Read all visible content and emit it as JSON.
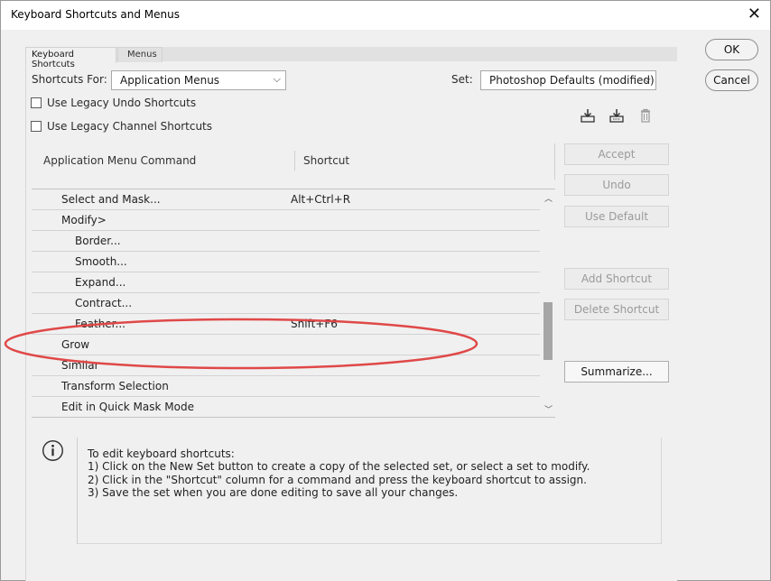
{
  "window": {
    "title": "Keyboard Shortcuts and Menus"
  },
  "tabs": [
    {
      "label": "Keyboard Shortcuts",
      "active": true
    },
    {
      "label": "Menus",
      "active": false
    }
  ],
  "shortcuts_for": {
    "label": "Shortcuts For:",
    "value": "Application Menus"
  },
  "set": {
    "label": "Set:",
    "value": "Photoshop Defaults (modified)"
  },
  "checkboxes": [
    {
      "label": "Use Legacy Undo Shortcuts",
      "checked": false
    },
    {
      "label": "Use Legacy Channel Shortcuts",
      "checked": false
    }
  ],
  "icons": [
    "save-set-icon",
    "save-as-set-icon",
    "delete-set-icon"
  ],
  "columns": {
    "command": "Application Menu Command",
    "shortcut": "Shortcut"
  },
  "rows": [
    {
      "command": "Select and Mask...",
      "shortcut": "Alt+Ctrl+R",
      "level": 1
    },
    {
      "command": "Modify>",
      "shortcut": "",
      "level": 1
    },
    {
      "command": "Border...",
      "shortcut": "",
      "level": 2
    },
    {
      "command": "Smooth...",
      "shortcut": "",
      "level": 2
    },
    {
      "command": "Expand...",
      "shortcut": "",
      "level": 2
    },
    {
      "command": "Contract...",
      "shortcut": "",
      "level": 2
    },
    {
      "command": "Feather...",
      "shortcut": "Shift+F6",
      "level": 2
    },
    {
      "command": "Grow",
      "shortcut": "",
      "level": 1
    },
    {
      "command": "Similar",
      "shortcut": "",
      "level": 1
    },
    {
      "command": "Transform Selection",
      "shortcut": "",
      "level": 1
    },
    {
      "command": "Edit in Quick Mask Mode",
      "shortcut": "",
      "level": 1
    }
  ],
  "side_buttons": {
    "accept": "Accept",
    "undo": "Undo",
    "use_default": "Use Default",
    "add_shortcut": "Add Shortcut",
    "delete_shortcut": "Delete Shortcut",
    "summarize": "Summarize..."
  },
  "dialog_buttons": {
    "ok": "OK",
    "cancel": "Cancel"
  },
  "info": {
    "lines": [
      "To edit keyboard shortcuts:",
      "1) Click on the New Set button to create a copy of the selected set, or select a set to modify.",
      "2) Click in the \"Shortcut\" column for a command and press the keyboard shortcut to assign.",
      "3) Save the set when you are done editing to save all your changes."
    ]
  },
  "colors": {
    "annotation": "#e04848",
    "thumb": "#a6a6a6"
  }
}
